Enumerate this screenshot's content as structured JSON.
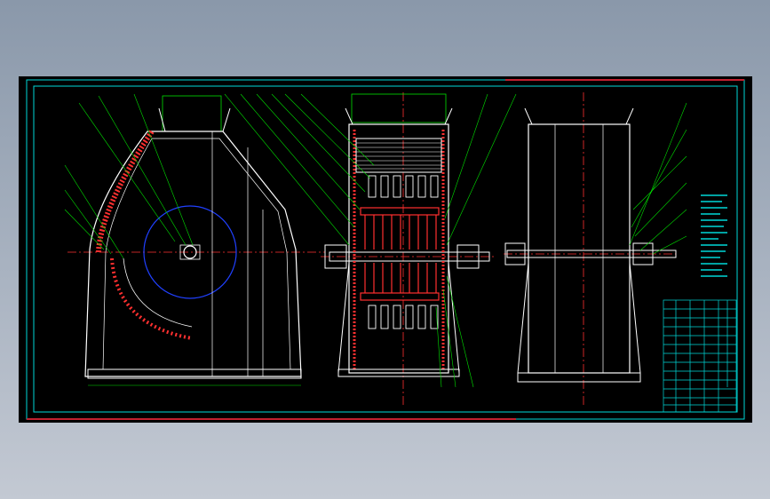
{
  "colors": {
    "background": "#000000",
    "outline": "#ffffff",
    "frame": "#00d8d8",
    "leader": "#00e000",
    "hammer": "#ff3030",
    "hub_circle": "#2040ff",
    "centerline": "#ff3030",
    "frame_accent": "#c02030"
  }
}
